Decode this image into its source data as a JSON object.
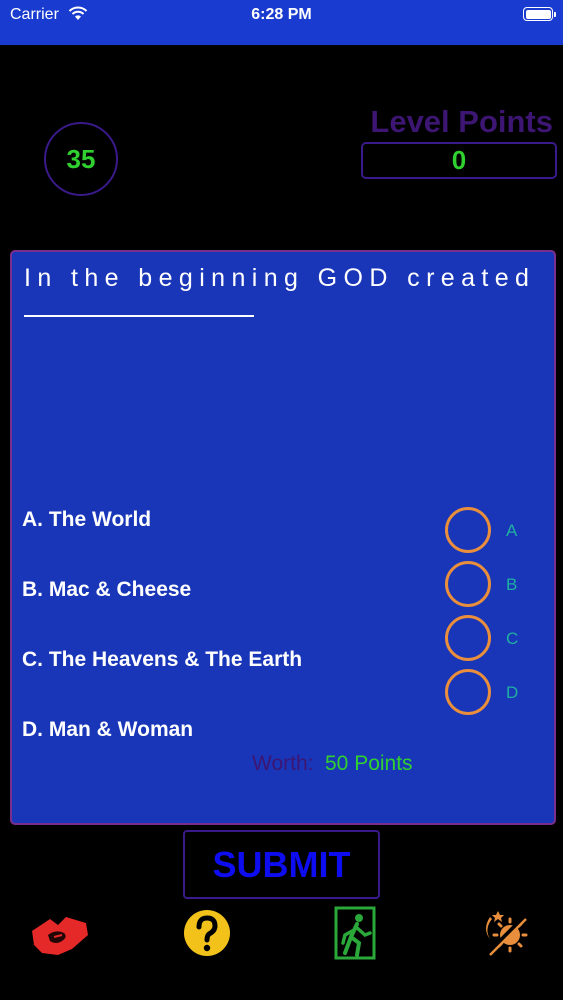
{
  "status_bar": {
    "carrier": "Carrier",
    "time": "6:28 PM"
  },
  "timer": {
    "value": "35"
  },
  "level_points": {
    "label": "Level Points",
    "value": "0"
  },
  "question": {
    "text": "In the beginning GOD created"
  },
  "answers": [
    {
      "label": "A. The World",
      "letter": "A"
    },
    {
      "label": "B. Mac & Cheese",
      "letter": "B"
    },
    {
      "label": "C. The Heavens & The Earth",
      "letter": "C"
    },
    {
      "label": "D. Man & Woman",
      "letter": "D"
    }
  ],
  "worth": {
    "label": "Worth:",
    "value": "50 Points"
  },
  "submit_label": "SUBMIT",
  "toolbar": {
    "icons": [
      "handshake-icon",
      "help-icon",
      "exit-icon",
      "day-night-icon"
    ]
  },
  "colors": {
    "status_bar_bg": "#1a3bcf",
    "card_bg": "#1936b8",
    "accent_green": "#2fd02f",
    "radio_orange": "#e88e3c",
    "submit_blue": "#0d0df0"
  }
}
